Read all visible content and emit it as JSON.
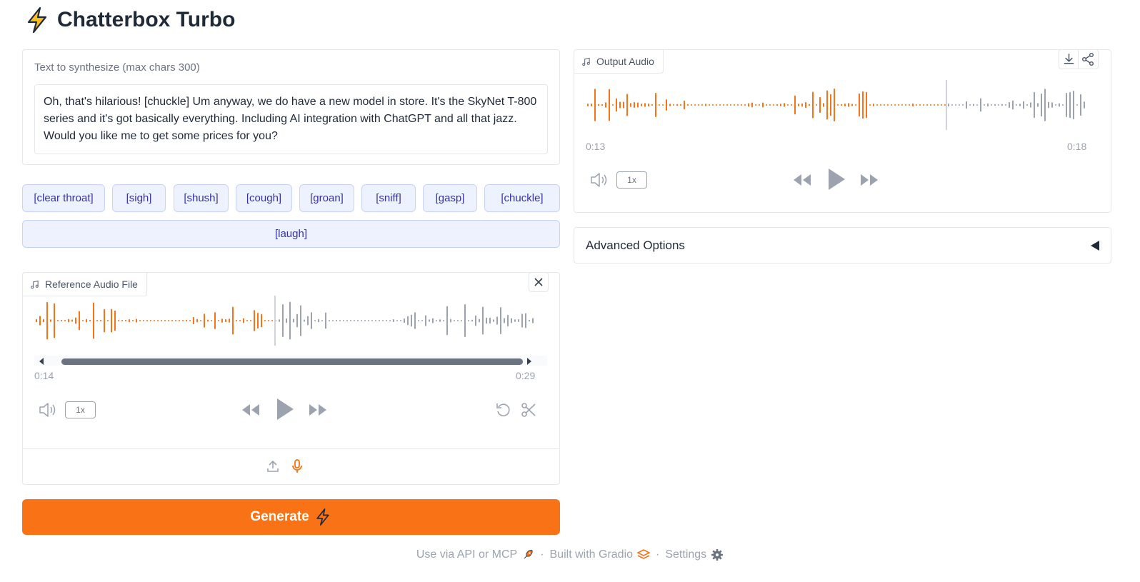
{
  "app": {
    "title": "Chatterbox Turbo",
    "title_icon": "lightning-icon"
  },
  "text_input": {
    "label": "Text to synthesize (max chars 300)",
    "value": "Oh, that's hilarious! [chuckle] Um anyway, we do have a new model in store. It's the SkyNet T-800 series and it's got basically everything. Including AI integration with ChatGPT and all that jazz. Would you like me to get some prices for you?"
  },
  "tags": [
    "[clear throat]",
    "[sigh]",
    "[shush]",
    "[cough]",
    "[groan]",
    "[sniff]",
    "[gasp]",
    "[chuckle]",
    "[laugh]"
  ],
  "reference_audio": {
    "label": "Reference Audio File",
    "current_time": "0:14",
    "duration": "0:29",
    "playback_rate": "1x",
    "progress": 0.48
  },
  "generate": {
    "label": "Generate"
  },
  "output_audio": {
    "label": "Output Audio",
    "current_time": "0:13",
    "duration": "0:18",
    "playback_rate": "1x",
    "progress": 0.72
  },
  "advanced": {
    "label": "Advanced Options"
  },
  "footer": {
    "api": "Use via API or MCP",
    "built": "Built with Gradio",
    "settings": "Settings",
    "separator": "·"
  },
  "colors": {
    "accent": "#f97316",
    "played": "#f97316",
    "unplayed": "#9ca3af",
    "tag_bg": "#eef2ff",
    "tag_text": "#3730a3"
  }
}
